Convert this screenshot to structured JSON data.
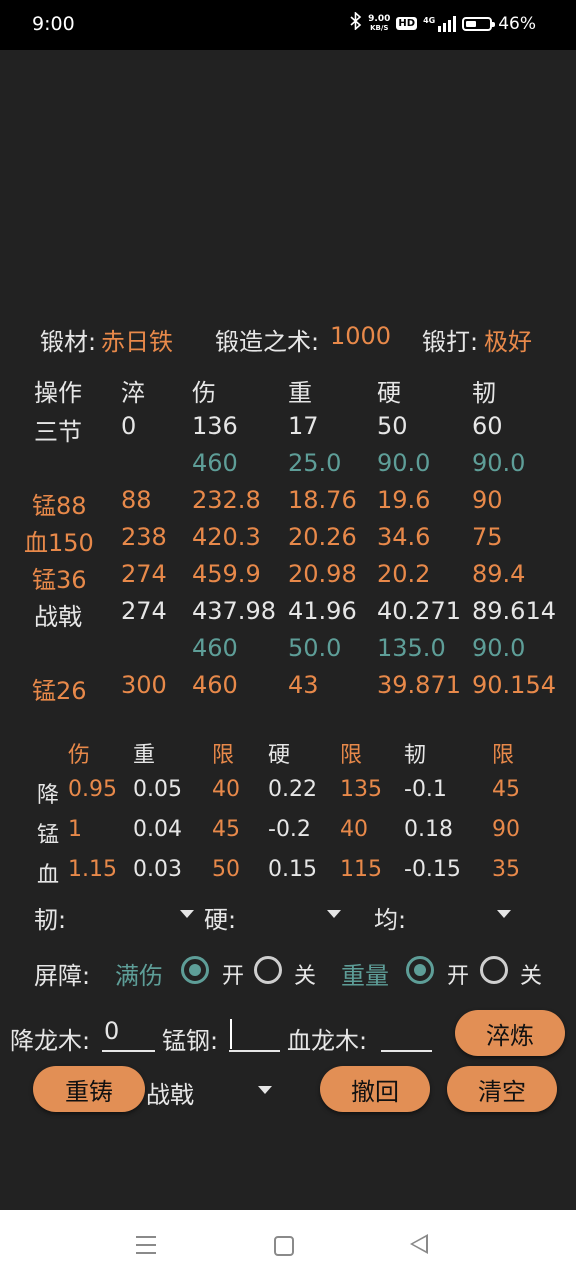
{
  "status_bar": {
    "time": "9:00",
    "net_speed_value": "9.00",
    "net_speed_unit": "KB/S",
    "hd_badge": "HD",
    "signal_label": "4G",
    "battery_percent": "46%",
    "battery_level": 0.46
  },
  "info": {
    "material_label": "锻材:",
    "material_value": "赤日铁",
    "skill_label": "锻造之术:",
    "skill_value": "1000",
    "forge_label": "锻打:",
    "forge_value": "极好"
  },
  "table": {
    "headers": [
      "操作",
      "淬",
      "伤",
      "重",
      "硬",
      "韧"
    ],
    "rows": [
      {
        "cells": [
          "三节",
          "0",
          "136",
          "17",
          "50",
          "60"
        ],
        "style": "white"
      },
      {
        "cells": [
          "",
          "",
          "460",
          "25.0",
          "90.0",
          "90.0"
        ],
        "style": "teal"
      },
      {
        "cells": [
          "锰88",
          "88",
          "232.8",
          "18.76",
          "19.6",
          "90"
        ],
        "style": "orange"
      },
      {
        "cells": [
          "血150",
          "238",
          "420.3",
          "20.26",
          "34.6",
          "75"
        ],
        "style": "orange"
      },
      {
        "cells": [
          "锰36",
          "274",
          "459.9",
          "20.98",
          "20.2",
          "89.4"
        ],
        "style": "orange"
      },
      {
        "cells": [
          "战戟",
          "274",
          "437.98",
          "41.96",
          "40.271",
          "89.614"
        ],
        "style": "white"
      },
      {
        "cells": [
          "",
          "",
          "460",
          "50.0",
          "135.0",
          "90.0"
        ],
        "style": "teal"
      },
      {
        "cells": [
          "锰26",
          "300",
          "460",
          "43",
          "39.871",
          "90.154"
        ],
        "style": "orange"
      }
    ]
  },
  "params": {
    "headers": [
      "伤",
      "重",
      "限",
      "硬",
      "限",
      "韧",
      "限"
    ],
    "rows": [
      {
        "name": "降",
        "values": [
          "0.95",
          "0.05",
          "40",
          "0.22",
          "135",
          "-0.1",
          "45"
        ]
      },
      {
        "name": "锰",
        "values": [
          "1",
          "0.04",
          "45",
          "-0.2",
          "40",
          "0.18",
          "90"
        ]
      },
      {
        "name": "血",
        "values": [
          "1.15",
          "0.03",
          "50",
          "0.15",
          "115",
          "-0.15",
          "35"
        ]
      }
    ]
  },
  "dropdowns": {
    "ren_label": "韧:",
    "ying_label": "硬:",
    "jun_label": "均:"
  },
  "barrier": {
    "label": "屏障:",
    "opt1_label": "满伤",
    "opt1_on": "开",
    "opt1_off": "关",
    "opt1_selected": "开",
    "opt2_label": "重量",
    "opt2_on": "开",
    "opt2_off": "关",
    "opt2_selected": "开"
  },
  "inputs": {
    "jianglongmu_label": "降龙木:",
    "jianglongmu_value": "0",
    "menggang_label": "锰钢:",
    "menggang_value": "",
    "xuelongmu_label": "血龙木:",
    "xuelongmu_value": "",
    "quench_button": "淬炼"
  },
  "actions": {
    "recast_button": "重铸",
    "weapon_select": "战戟",
    "undo_button": "撤回",
    "clear_button": "清空"
  }
}
